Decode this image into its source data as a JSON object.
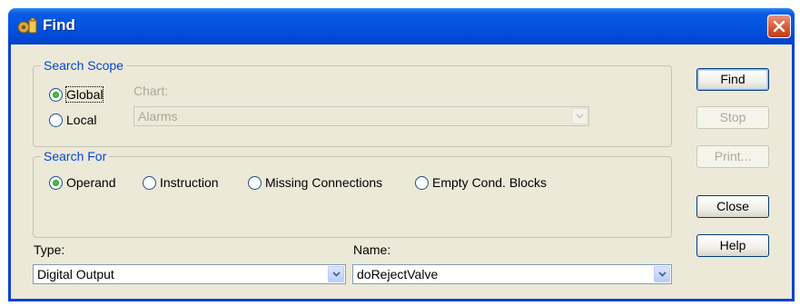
{
  "window": {
    "title": "Find"
  },
  "search_scope": {
    "legend": "Search Scope",
    "options": [
      {
        "label": "Global",
        "selected": true
      },
      {
        "label": "Local",
        "selected": false
      }
    ],
    "chart_label": "Chart:",
    "chart_value": "Alarms"
  },
  "search_for": {
    "legend": "Search For",
    "options": [
      {
        "label": "Operand",
        "selected": true
      },
      {
        "label": "Instruction",
        "selected": false
      },
      {
        "label": "Missing Connections",
        "selected": false
      },
      {
        "label": "Empty Cond. Blocks",
        "selected": false
      }
    ]
  },
  "type_field": {
    "label": "Type:",
    "value": "Digital Output"
  },
  "name_field": {
    "label": "Name:",
    "value": "doRejectValve"
  },
  "buttons": {
    "find": "Find",
    "stop": "Stop",
    "print": "Print...",
    "close": "Close",
    "help": "Help"
  },
  "colors": {
    "titlebar": "#0454e0",
    "dialog_bg": "#ece9d8",
    "group_legend": "#0046d5",
    "close_button": "#d55a38"
  }
}
